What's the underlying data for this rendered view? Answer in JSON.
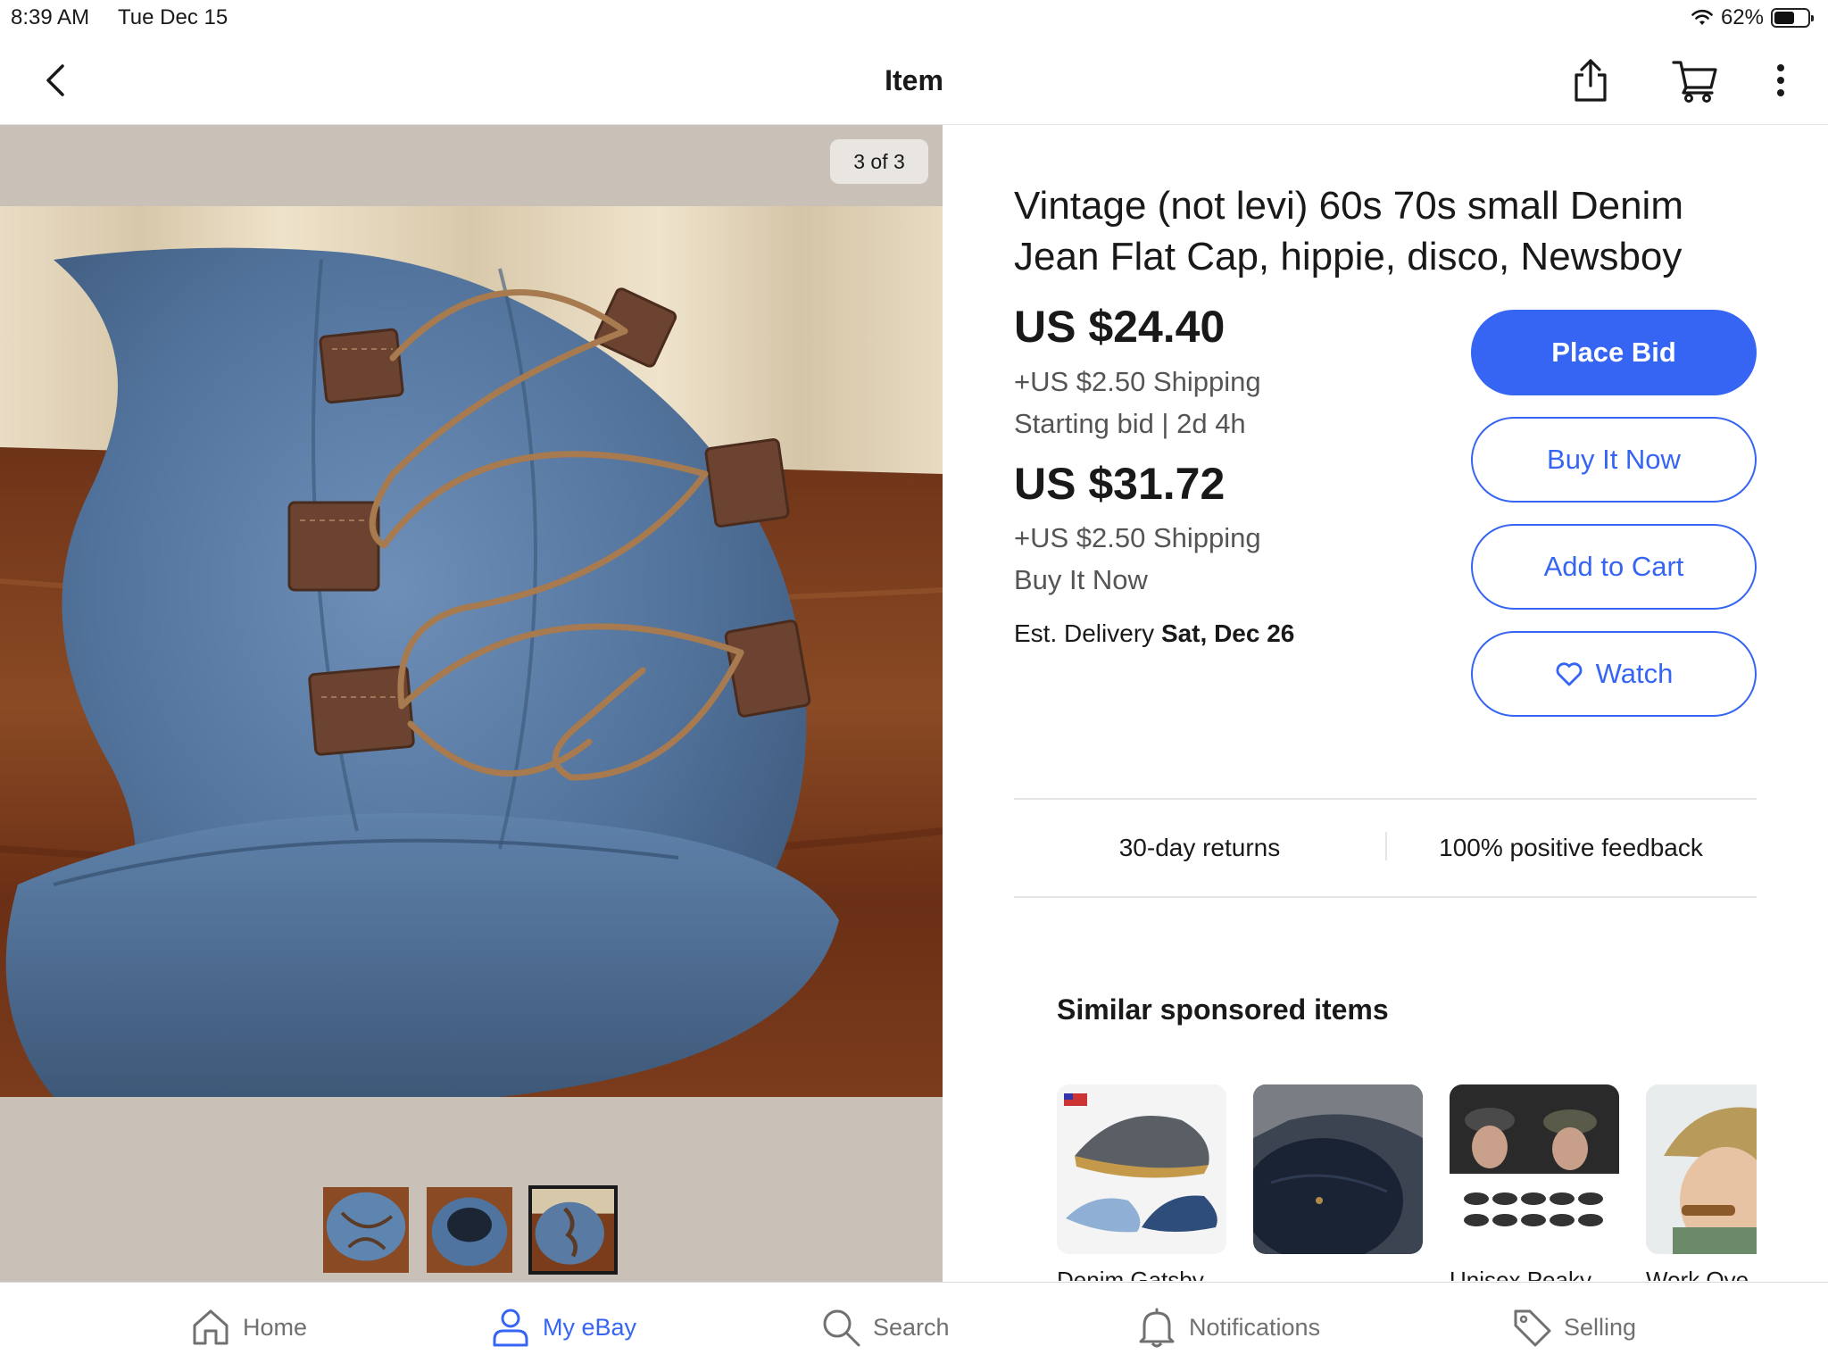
{
  "status_bar": {
    "time": "8:39 AM",
    "date": "Tue Dec 15",
    "battery": "62%",
    "battery_level": 0.62
  },
  "nav": {
    "title": "Item",
    "back_icon": "chevron-left-icon",
    "share_icon": "share-icon",
    "cart_icon": "cart-icon",
    "more_icon": "more-vertical-icon"
  },
  "gallery": {
    "counter": "3 of 3",
    "thumbnail_count": 3,
    "active_thumbnail": 3
  },
  "item": {
    "title": "Vintage (not levi) 60s 70s small  Denim Jean Flat Cap, hippie, disco, Newsboy",
    "bid_price": "US $24.40",
    "bid_shipping": "+US $2.50 Shipping",
    "bid_meta": "Starting bid | 2d 4h",
    "bin_price": "US $31.72",
    "bin_shipping": "+US $2.50 Shipping",
    "bin_meta": "Buy It Now",
    "delivery_label": "Est. Delivery ",
    "delivery_date": "Sat, Dec 26"
  },
  "actions": {
    "place_bid": "Place Bid",
    "buy_it_now": "Buy It Now",
    "add_to_cart": "Add to Cart",
    "watch": "Watch"
  },
  "features": {
    "returns": "30-day returns",
    "feedback": "100% positive feedback"
  },
  "similar": {
    "title": "Similar sponsored items",
    "items": [
      {
        "label": "Denim Gatsby"
      },
      {
        "label": ""
      },
      {
        "label": "Unisex Peaky"
      },
      {
        "label": "Work Ove"
      }
    ]
  },
  "tabs": [
    {
      "label": "Home",
      "icon": "home-icon"
    },
    {
      "label": "My eBay",
      "icon": "user-icon"
    },
    {
      "label": "Search",
      "icon": "search-icon"
    },
    {
      "label": "Notifications",
      "icon": "bell-icon"
    },
    {
      "label": "Selling",
      "icon": "tag-icon"
    }
  ],
  "colors": {
    "accent": "#3665f3",
    "text": "#191919",
    "secondary_text": "#555555",
    "gallery_bg": "#c9c0b8"
  }
}
